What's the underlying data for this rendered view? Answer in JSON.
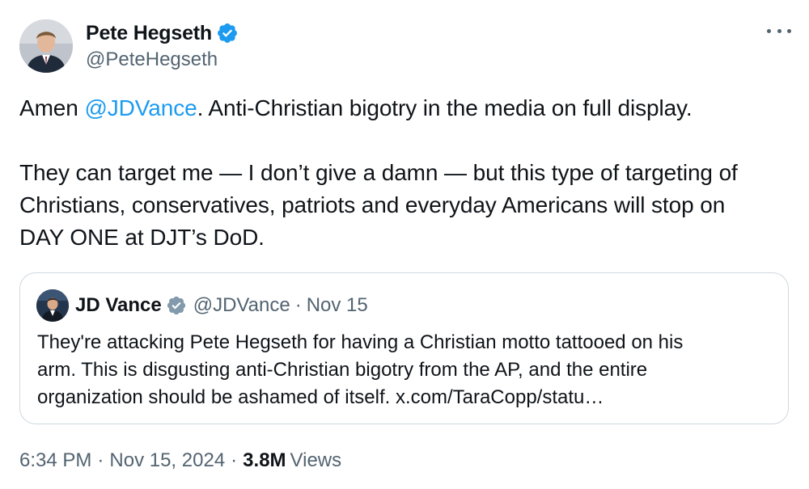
{
  "author": {
    "display_name": "Pete Hegseth",
    "handle": "@PeteHegseth",
    "verified_icon": "verified-badge-icon",
    "verified_color": "#1d9bf0"
  },
  "more_menu_icon": "more-horizontal-icon",
  "tweet": {
    "paragraph1_prefix": "Amen ",
    "paragraph1_mention": "@JDVance",
    "paragraph1_suffix": ". Anti-Christian bigotry in the media on full display.",
    "paragraph2_line1": "They can target me — I don’t give a damn — but this type of targeting of",
    "paragraph2_line2": "Christians, conservatives, patriots and everyday Americans will stop on",
    "paragraph2_line3": "DAY ONE at DJT’s DoD."
  },
  "quoted_tweet": {
    "display_name": "JD Vance",
    "verified_icon": "gray-verified-badge-icon",
    "verified_color": "#829aab",
    "handle": "@JDVance",
    "separator": "·",
    "date": "Nov 15",
    "line1": "They're attacking Pete Hegseth for having a Christian motto tattooed on his",
    "line2": "arm. This is disgusting anti-Christian bigotry from the AP, and the entire",
    "line3": "organization should be ashamed of itself. x.com/TaraCopp/statu…"
  },
  "footer": {
    "time": "6:34 PM",
    "separator1": "·",
    "date": "Nov 15, 2024",
    "separator2": "·",
    "views_count": "3.8M",
    "views_label": "Views"
  },
  "colors": {
    "link": "#1d9bf0",
    "secondary_text": "#536471",
    "primary_text": "#0f1419",
    "border": "#cfd9de"
  }
}
